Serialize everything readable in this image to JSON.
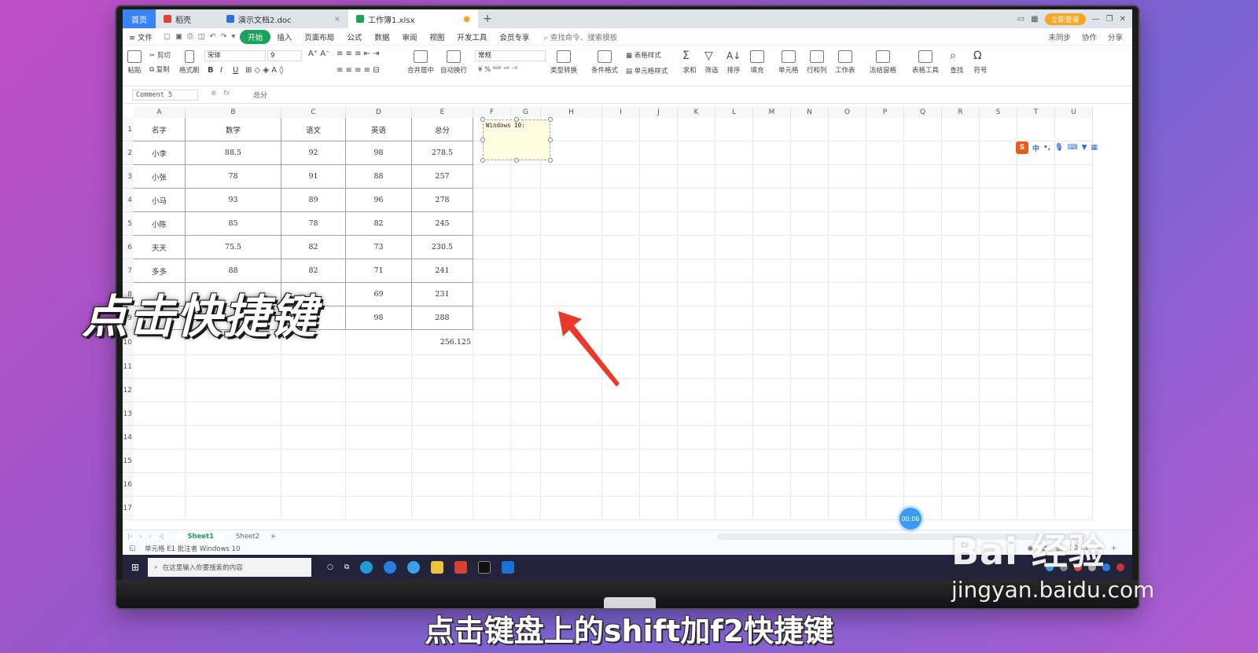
{
  "tabs": [
    {
      "label": "首页",
      "kind": "home"
    },
    {
      "label": "稻壳",
      "kind": "docer",
      "color": "#e0432f"
    },
    {
      "label": "演示文档2.doc",
      "kind": "doc",
      "color": "#2f6fd8"
    },
    {
      "label": "工作簿1.xlsx",
      "kind": "sheet",
      "color": "#1aa35a"
    }
  ],
  "title_login": "立即登录",
  "menu": {
    "file": "≡ 文件",
    "items": [
      "开始",
      "插入",
      "页面布局",
      "公式",
      "数据",
      "审阅",
      "视图",
      "开发工具",
      "会员专享"
    ],
    "active": "开始",
    "search": "查找命令、搜索模板",
    "right": [
      "未同步",
      "协作",
      "分享"
    ]
  },
  "ribbon": {
    "paste": "粘贴",
    "cut": "剪切",
    "copy": "复制",
    "format_painter": "格式刷",
    "font_name": "宋体",
    "font_size": "9",
    "number_format": "常规",
    "merge": "合并居中",
    "wrap": "自动换行",
    "convert": "类型转换",
    "cond_format": "条件格式",
    "table_style": "表格样式",
    "cell_style": "单元格样式",
    "sum": "求和",
    "filter": "筛选",
    "sort": "排序",
    "fill": "填充",
    "cells": "单元格",
    "rowcol": "行和列",
    "sheet": "工作表",
    "freeze": "冻结窗格",
    "table_tools": "表格工具",
    "find": "查找",
    "symbol": "符号"
  },
  "formula": {
    "namebox": "Comment 5",
    "fx": "fx",
    "value": "总分"
  },
  "columns": [
    "A",
    "B",
    "C",
    "D",
    "E",
    "F",
    "G",
    "H",
    "I",
    "J",
    "K",
    "L",
    "M",
    "N",
    "O",
    "P",
    "Q",
    "R",
    "S",
    "T",
    "U"
  ],
  "rows": [
    "1",
    "2",
    "3",
    "4",
    "5",
    "6",
    "7",
    "8",
    "9",
    "10",
    "11",
    "12",
    "13",
    "14",
    "15",
    "16",
    "17"
  ],
  "table": {
    "header": [
      "名字",
      "数学",
      "语文",
      "英语",
      "总分"
    ],
    "data": [
      [
        "小李",
        "88.5",
        "92",
        "98",
        "278.5"
      ],
      [
        "小张",
        "78",
        "91",
        "88",
        "257"
      ],
      [
        "小马",
        "93",
        "89",
        "96",
        "278"
      ],
      [
        "小陈",
        "85",
        "78",
        "82",
        "245"
      ],
      [
        "天天",
        "75.5",
        "82",
        "73",
        "230.5"
      ],
      [
        "多多",
        "88",
        "82",
        "71",
        "241"
      ],
      [
        "",
        "",
        "",
        "69",
        "231"
      ],
      [
        "",
        "",
        "",
        "98",
        "288"
      ]
    ],
    "average": "256.125"
  },
  "comment_text": "Windows 10:",
  "ime": {
    "logo": "S",
    "mode": "中"
  },
  "sheets": [
    "Sheet1",
    "Sheet2"
  ],
  "sheet_add": "+",
  "status": {
    "left": "单元格 E1 批注者 Windows 10",
    "zoom": "100%"
  },
  "taskbar": {
    "search_placeholder": "在这里输入你要搜索的内容"
  },
  "timer": "00:06",
  "overlay_text": "点击快捷键",
  "subtitle": "点击键盘上的shift加f2快捷键",
  "watermark": {
    "logo": "Bai 经验",
    "url": "jingyan.baidu.com"
  },
  "colors": {
    "accent": "#1aa35a",
    "arrow": "#e8392a",
    "comment_bg": "#fffbe0"
  }
}
